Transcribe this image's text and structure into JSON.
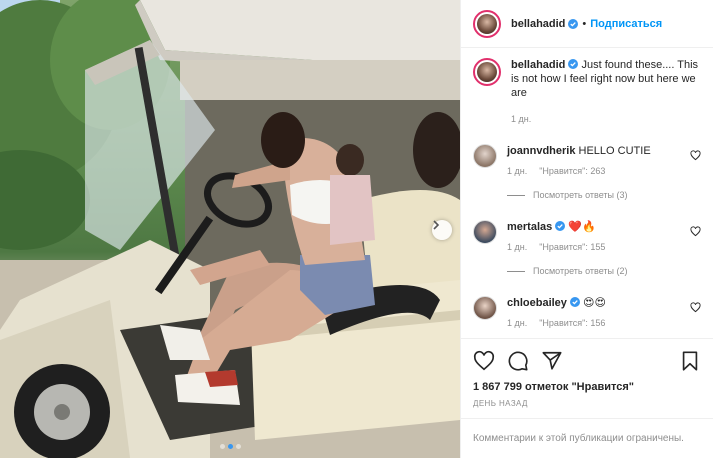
{
  "author": {
    "username": "bellahadid",
    "follow_label": "Подписаться",
    "separator": "•"
  },
  "caption": {
    "username": "bellahadid",
    "text": "Just found these.... This is not how I feel right now but here we are",
    "time": "1 дн."
  },
  "comments": [
    {
      "username": "joannvdherik",
      "text": "HELLO CUTIE",
      "time": "1 дн.",
      "likes": "\"Нравится\": 263",
      "replies": "Посмотреть ответы (3)",
      "verified": false
    },
    {
      "username": "mertalas",
      "text": "❤️🔥",
      "time": "1 дн.",
      "likes": "\"Нравится\": 155",
      "replies": "Посмотреть ответы (2)",
      "verified": true
    },
    {
      "username": "chloebailey",
      "text": "😍😍",
      "time": "1 дн.",
      "likes": "\"Нравится\": 156",
      "verified": true
    }
  ],
  "likes_label": "1 867 799 отметок \"Нравится\"",
  "date_label": "ДЕНЬ НАЗАД",
  "comments_disabled": "Комментарии к этой публикации ограничены.",
  "carousel": {
    "slides": 3,
    "active_index": 1
  },
  "colors": {
    "accent": "#0095f6",
    "verified": "#3897f0",
    "muted": "#8e8e8e"
  }
}
